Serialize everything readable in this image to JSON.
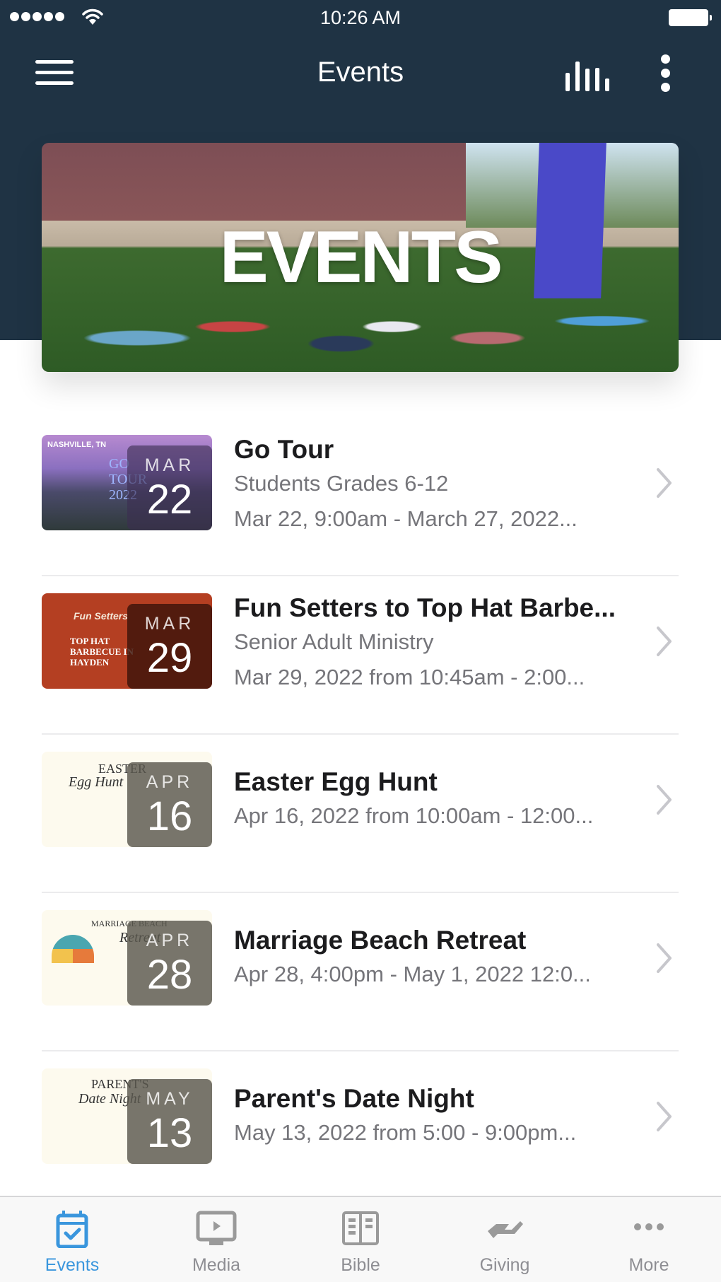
{
  "status_bar": {
    "time": "10:26 AM",
    "signal_bars": 5,
    "battery_level": 1.0
  },
  "nav": {
    "title": "Events",
    "menu_icon": "hamburger-icon",
    "chart_icon": "bar-chart-icon",
    "more_icon": "more-vertical-icon"
  },
  "banner": {
    "text": "EVENTS"
  },
  "colors": {
    "header": "#1f3344",
    "accent": "#3a96dd",
    "inactive": "#8e8e93",
    "title": "#1c1c1e",
    "subtitle": "#75757a"
  },
  "events": [
    {
      "title": "Go Tour",
      "subtitle": "Students Grades 6-12",
      "when": "Mar 22, 9:00am - March 27, 2022...",
      "month": "MAR",
      "day": "22",
      "thumb_caption": "NASHVILLE, TN",
      "thumb_title": "GO TOUR 2022"
    },
    {
      "title": "Fun Setters to Top Hat Barbe...",
      "subtitle": "Senior Adult Ministry",
      "when": "Mar 29, 2022 from 10:45am - 2:00...",
      "month": "MAR",
      "day": "29",
      "thumb_caption": "Fun Setters",
      "thumb_title": "TOP HAT BARBECUE IN HAYDEN"
    },
    {
      "title": "Easter Egg Hunt",
      "when": "Apr 16, 2022 from 10:00am - 12:00...",
      "month": "APR",
      "day": "16",
      "thumb_caption": "EASTER",
      "thumb_title": "Egg Hunt"
    },
    {
      "title": "Marriage Beach Retreat",
      "when": "Apr 28, 4:00pm - May 1, 2022 12:0...",
      "month": "APR",
      "day": "28",
      "thumb_caption": "MARRIAGE BEACH",
      "thumb_title": "Retreat"
    },
    {
      "title": "Parent's Date Night",
      "when": "May 13, 2022 from 5:00 - 9:00pm...",
      "month": "MAY",
      "day": "13",
      "thumb_caption": "PARENT'S",
      "thumb_title": "Date Night"
    }
  ],
  "tabs": [
    {
      "label": "Events",
      "icon": "calendar-check-icon",
      "active": true
    },
    {
      "label": "Media",
      "icon": "tv-play-icon",
      "active": false
    },
    {
      "label": "Bible",
      "icon": "open-book-icon",
      "active": false
    },
    {
      "label": "Giving",
      "icon": "giving-hand-icon",
      "active": false
    },
    {
      "label": "More",
      "icon": "more-horizontal-icon",
      "active": false
    }
  ]
}
